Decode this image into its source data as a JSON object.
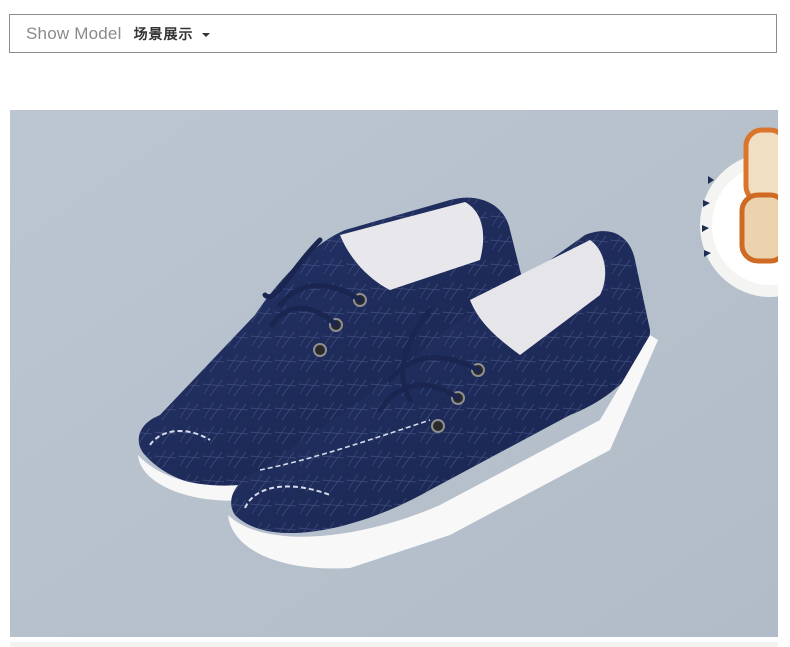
{
  "header": {
    "title_en": "Show Model",
    "title_cn": "场景展示"
  },
  "photo": {
    "subject": "navy-canvas-lace-up-shoes"
  },
  "colors": {
    "background": "#b7c2cd",
    "shoe": "#1d2b5a",
    "sole": "#f5f5f5",
    "border": "#8c8c8c"
  }
}
